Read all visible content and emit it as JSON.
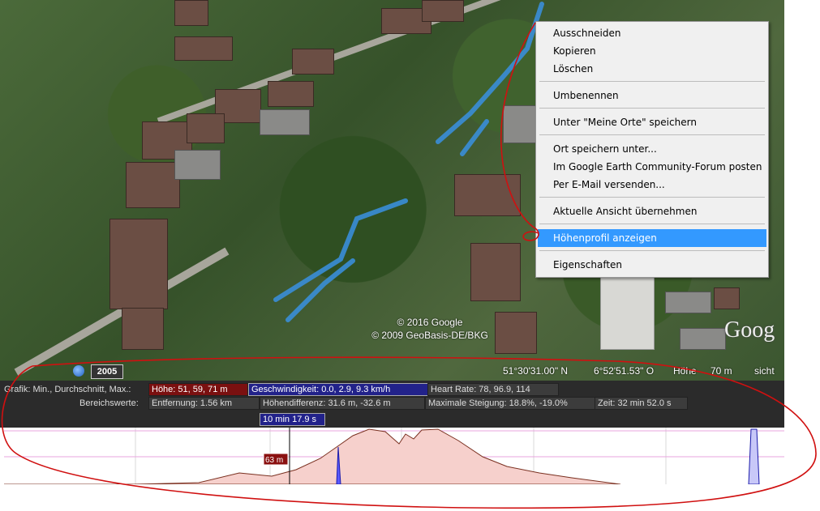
{
  "map": {
    "copyright_line1": "© 2016 Google",
    "copyright_line2": "© 2009 GeoBasis-DE/BKG",
    "logo": "Goog",
    "year": "2005"
  },
  "statusbar": {
    "latitude": "51°30'31.00\" N",
    "longitude": "6°52'51.53\" O",
    "altitude_label": "Höhe",
    "altitude_value": "70 m",
    "visibility": "sicht"
  },
  "profile_panel": {
    "graph_label": "Grafik: Min., Durchschnitt, Max.:",
    "hoehe": "Höhe: 51, 59, 71 m",
    "geschwindigkeit": "Geschwindigkeit: 0.0, 2.9, 9.3 km/h",
    "heart_rate": "Heart Rate: 78, 96.9, 114",
    "range_label": "Bereichswerte:",
    "entfernung": "Entfernung: 1.56 km",
    "hoehendifferenz": "Höhendifferenz: 31.6 m, -32.6 m",
    "steigung": "Maximale Steigung: 18.8%, -19.0%",
    "zeit": "Zeit: 32 min 52.0 s",
    "time_marker": "10 min 17.9 s",
    "elevation_marker": "63 m"
  },
  "context_menu": {
    "items": [
      {
        "label": "Ausschneiden"
      },
      {
        "label": "Kopieren"
      },
      {
        "label": "Löschen"
      },
      {
        "label": "Umbenennen"
      },
      {
        "label": "Unter \"Meine Orte\" speichern"
      },
      {
        "label": "Ort speichern unter..."
      },
      {
        "label": "Im Google Earth Community-Forum posten"
      },
      {
        "label": "Per E-Mail versenden..."
      },
      {
        "label": "Aktuelle Ansicht übernehmen"
      },
      {
        "label": "Höhenprofil anzeigen"
      },
      {
        "label": "Eigenschaften"
      }
    ],
    "highlighted_index": 9
  },
  "colors": {
    "menu_highlight": "#3399ff",
    "track": "#3a8ed8",
    "annotation": "#d01010",
    "profile_fill": "#f6d0cc"
  }
}
